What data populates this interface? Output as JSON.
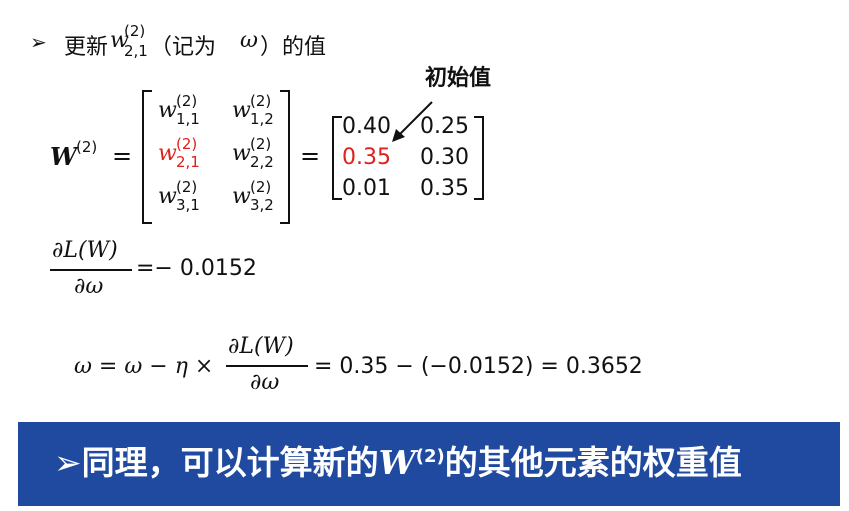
{
  "line1": {
    "bullet": "➢",
    "prefix": "更新",
    "var": "w",
    "sup": "(2)",
    "sub": "2,1",
    "suffix_open": "（记为",
    "omega": "ω",
    "suffix_close": "）的值"
  },
  "annotation": "初始值",
  "matrix_lhs": {
    "var": "W",
    "sup": "(2)",
    "eq": "="
  },
  "symbolic": [
    [
      {
        "v": "w",
        "sup": "(2)",
        "sub": "1,1"
      },
      {
        "v": "w",
        "sup": "(2)",
        "sub": "1,2"
      }
    ],
    [
      {
        "v": "w",
        "sup": "(2)",
        "sub": "2,1"
      },
      {
        "v": "w",
        "sup": "(2)",
        "sub": "2,2"
      }
    ],
    [
      {
        "v": "w",
        "sup": "(2)",
        "sub": "3,1"
      },
      {
        "v": "w",
        "sup": "(2)",
        "sub": "3,2"
      }
    ]
  ],
  "numeric": [
    [
      "0.40",
      "0.25"
    ],
    [
      "0.35",
      "0.30"
    ],
    [
      "0.01",
      "0.35"
    ]
  ],
  "eq2": "=",
  "grad": {
    "num": "∂L(W)",
    "den": "∂ω",
    "rhs": "=− 0.0152"
  },
  "update": {
    "lhs": "ω = ω − η ×",
    "num": "∂L(W)",
    "den": "∂ω",
    "rhs": "= 0.35 − (−0.0152) =  0.3652"
  },
  "banner": {
    "bullet": "➢",
    "text1": "同理，可以计算新的",
    "var": "W",
    "sup": "(2)",
    "text2": "的其他元素的权重值"
  },
  "colors": {
    "highlight": "#e0201a",
    "banner_bg": "#1f4aa0"
  }
}
